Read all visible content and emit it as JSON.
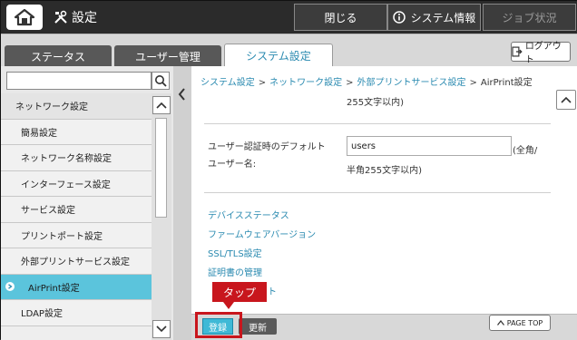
{
  "header": {
    "title": "設定",
    "close_label": "閉じる",
    "sysinfo_label": "システム情報",
    "job_status_label": "ジョブ状況"
  },
  "tabs": {
    "status": "ステータス",
    "user_mgmt": "ユーザー管理",
    "system_settings": "システム設定",
    "logout": "ログアウト"
  },
  "sidebar": {
    "items": [
      {
        "label": "ネットワーク設定"
      },
      {
        "label": "簡易設定"
      },
      {
        "label": "ネットワーク名称設定"
      },
      {
        "label": "インターフェース設定"
      },
      {
        "label": "サービス設定"
      },
      {
        "label": "プリントポート設定"
      },
      {
        "label": "外部プリントサービス設定"
      },
      {
        "label": "AirPrint設定"
      },
      {
        "label": "LDAP設定"
      }
    ]
  },
  "breadcrumb": {
    "item1": "システム設定",
    "item2": "ネットワーク設定",
    "item3": "外部プリントサービス設定",
    "current": "AirPrint設定",
    "sep": ">"
  },
  "content": {
    "top_note": "255文字以内)",
    "default_user_label_1": "ユーザー認証時のデフォルト",
    "default_user_label_2": "ユーザー名:",
    "default_user_value": "users",
    "default_user_note_1": "(全角/",
    "default_user_note_2": "半角255文字以内)",
    "links": [
      "デバイスステータス",
      "ファームウェアバージョン",
      "SSL/TLS設定",
      "証明書の管理",
      "ト"
    ]
  },
  "bottom": {
    "register_label": "登録",
    "update_label": "更新",
    "page_top_label": "PAGE TOP"
  },
  "callout": {
    "text": "タップ"
  }
}
